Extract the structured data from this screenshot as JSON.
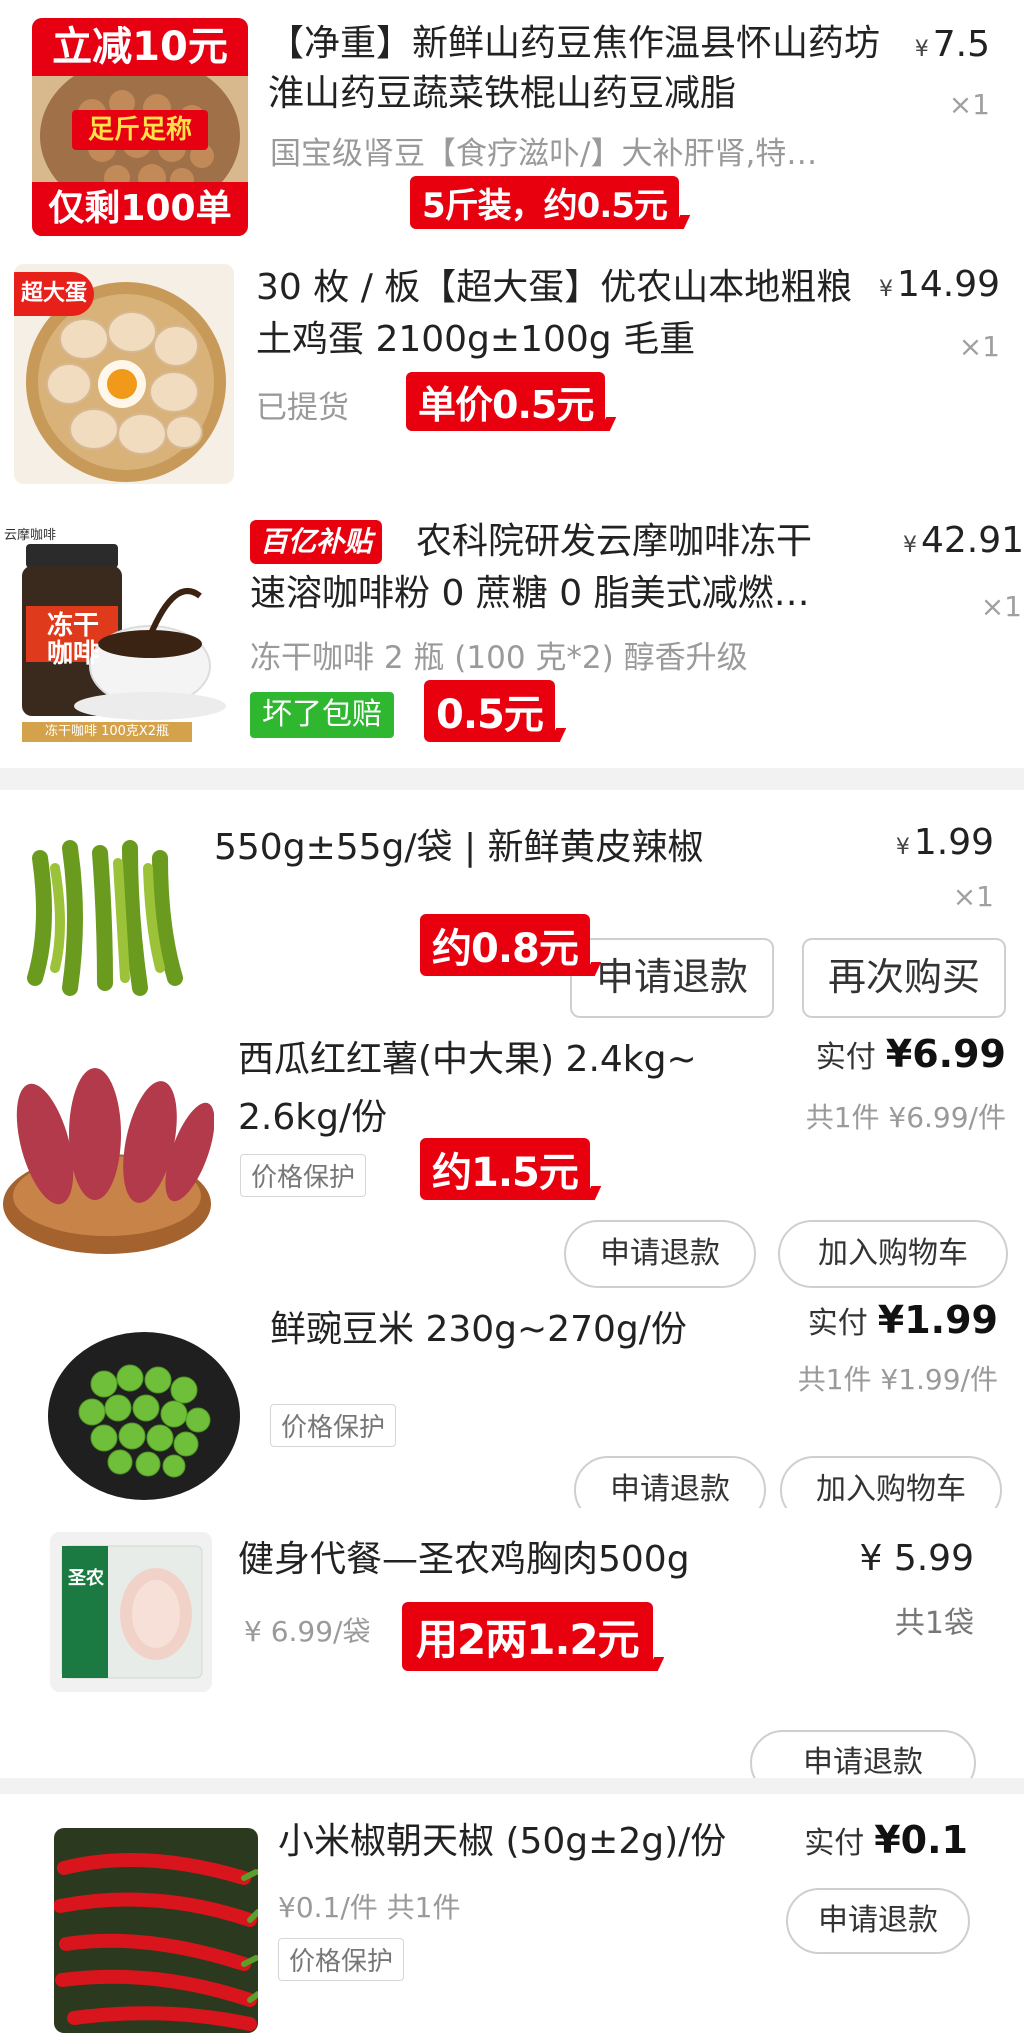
{
  "orders": [
    {
      "id": "yam",
      "thumb_top_text": "立减10元",
      "thumb_mid_text": "足斤足称",
      "thumb_bot_text": "仅剩100单",
      "title_line1": "【净重】新鲜山药豆焦作温县怀山药坊",
      "title_line2": "淮山药豆蔬菜铁棍山药豆减脂",
      "subtitle": "国宝级肾豆【食疗滋卟/】大补肝肾,特…",
      "price_symbol": "¥",
      "price": "7.5",
      "qty": "×1",
      "note": "5斤装，约0.5元"
    },
    {
      "id": "eggs",
      "badge": "超大蛋",
      "title_line1": "30 枚 / 板【超大蛋】优农山本地粗粮",
      "title_line2": "土鸡蛋 2100g±100g 毛重",
      "status": "已提货",
      "price_symbol": "¥",
      "price": "14.99",
      "qty": "×1",
      "note": "单价0.5元"
    },
    {
      "id": "coffee",
      "brand_small": "云摩咖啡",
      "jar_text_1": "冻干",
      "jar_text_2": "咖啡",
      "jar_caption": "冻干咖啡 100克X2瓶",
      "promo_badge": "百亿补贴",
      "title_line1": "农科院研发云摩咖啡冻干",
      "title_line2": "速溶咖啡粉 0 蔗糖 0 脂美式减燃…",
      "subtitle": "冻干咖啡 2 瓶 (100 克*2) 醇香升级",
      "green_badge": "坏了包赔",
      "price_symbol": "¥",
      "price": "42.91",
      "qty": "×1",
      "note": "0.5元"
    },
    {
      "id": "pepper",
      "title_line1": "550g±55g/袋 | 新鲜黄皮辣椒",
      "price_symbol": "¥",
      "price": "1.99",
      "qty": "×1",
      "note": "约0.8元",
      "btn_refund": "申请退款",
      "btn_rebuy": "再次购买"
    },
    {
      "id": "sweetpotato",
      "title_line1": "西瓜红红薯(中大果) 2.4kg~",
      "title_line2": "2.6kg/份",
      "tag": "价格保护",
      "paid_label": "实付",
      "paid_amount": "¥6.99",
      "unit_info": "共1件 ¥6.99/件",
      "note": "约1.5元",
      "btn_refund": "申请退款",
      "btn_cart": "加入购物车"
    },
    {
      "id": "peas",
      "title_line1": "鲜豌豆米 230g~270g/份",
      "tag": "价格保护",
      "paid_label": "实付",
      "paid_amount": "¥1.99",
      "unit_info": "共1件 ¥1.99/件",
      "btn_refund": "申请退款",
      "btn_cart": "加入购物车"
    },
    {
      "id": "chicken",
      "pack_text": "圣农",
      "title_line1": "健身代餐—圣农鸡胸肉500g",
      "unit_price": "¥ 6.99/袋",
      "price": "¥ 5.99",
      "qty": "共1袋",
      "note": "用2两1.2元",
      "btn_refund": "申请退款"
    },
    {
      "id": "chili",
      "title_line1": "小米椒朝天椒 (50g±2g)/份",
      "unit_info": "¥0.1/件  共1件",
      "tag": "价格保护",
      "paid_label": "实付",
      "paid_amount": "¥0.1",
      "btn_refund": "申请退款"
    }
  ],
  "colors": {
    "red": "#e8000f",
    "green": "#2fb82f",
    "gray_text": "#9a9a9a"
  }
}
